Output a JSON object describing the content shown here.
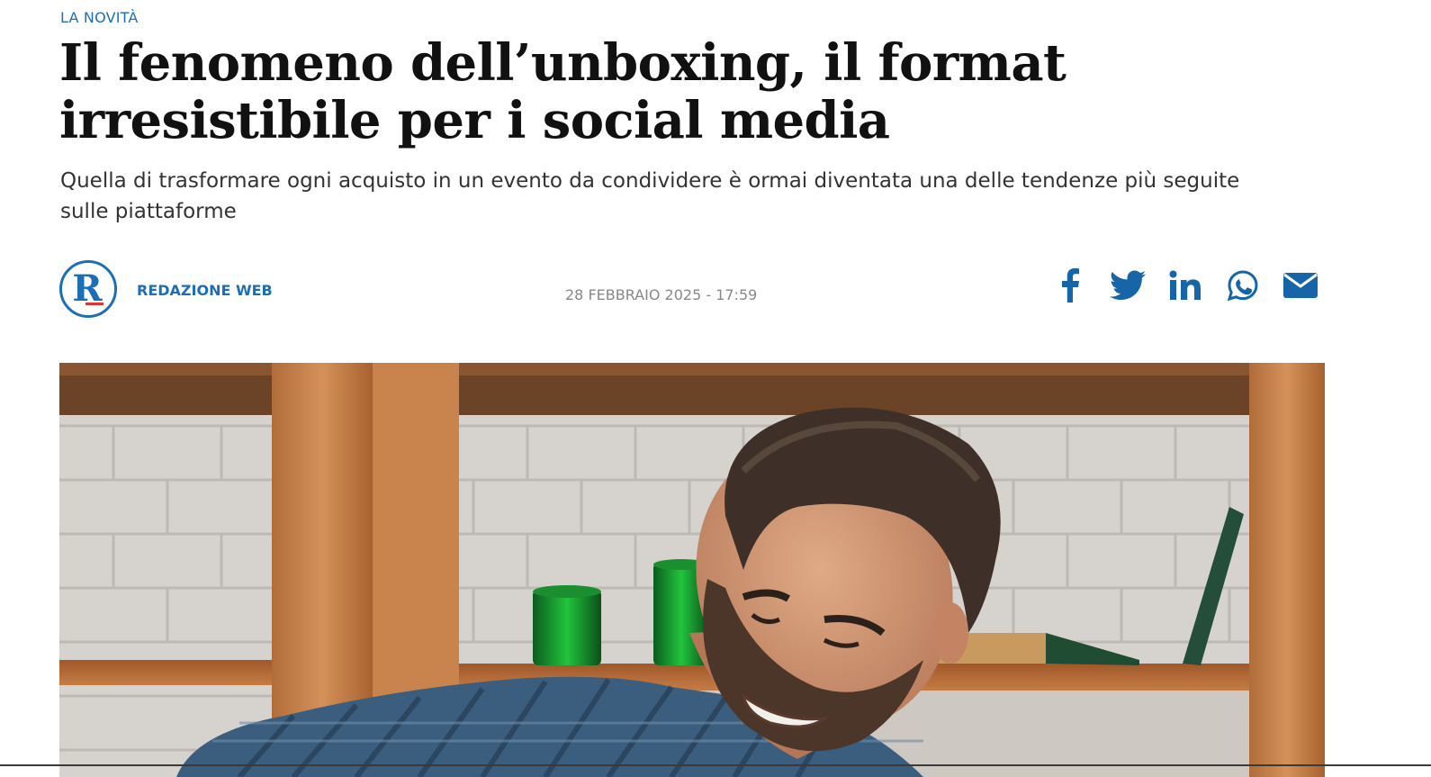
{
  "article": {
    "kicker": "LA NOVITÀ",
    "headline": "Il fenomeno dell’unboxing, il format irresistibile per i social media",
    "subtitle": "Quella di trasformare ogni acquisto in un evento da condividere è ormai diventata una delle tendenze più seguite sulle piattaforme",
    "author": "REDAZIONE WEB",
    "date": "28 FEBBRAIO 2025 - 17:59"
  },
  "author_logo": {
    "letter": "R",
    "icon": "publisher-logo"
  },
  "share_icons": [
    "facebook-icon",
    "twitter-icon",
    "linkedin-icon",
    "whatsapp-icon",
    "email-icon"
  ],
  "colors": {
    "accent": "#1d6fb5",
    "share_icons": "#1565a8",
    "headline": "#111111",
    "date": "#888888"
  },
  "hero_image": {
    "icon": "hero-photo-man-unboxing"
  }
}
